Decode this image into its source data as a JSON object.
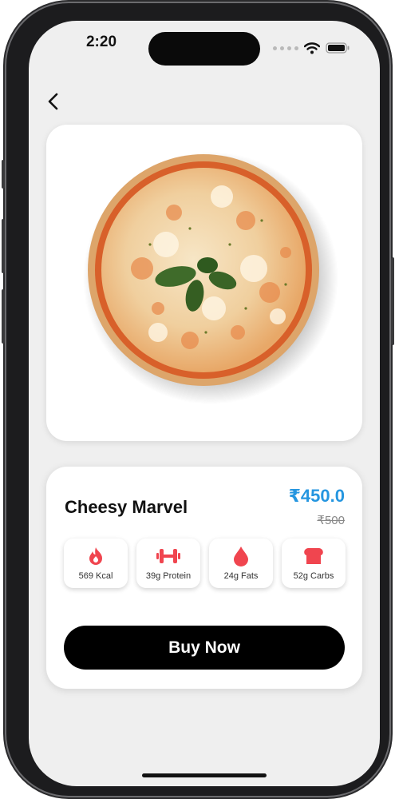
{
  "status_bar": {
    "time": "2:20",
    "icons": [
      "signal-dots-icon",
      "wifi-icon",
      "battery-icon"
    ]
  },
  "header": {
    "back_icon": "chevron-left-icon"
  },
  "product": {
    "image": "pizza-image",
    "name": "Cheesy Marvel",
    "price": "₹450.0",
    "original_price": "₹500",
    "nutrients": [
      {
        "icon": "flame-icon",
        "label": "569 Kcal"
      },
      {
        "icon": "dumbbell-icon",
        "label": "39g Protein"
      },
      {
        "icon": "drop-icon",
        "label": "24g Fats"
      },
      {
        "icon": "bread-icon",
        "label": "52g Carbs"
      }
    ]
  },
  "actions": {
    "buy_label": "Buy Now"
  },
  "colors": {
    "accent_price": "#2596e0",
    "nutrient_icon": "#f0454f",
    "button_bg": "#000000",
    "screen_bg": "#efefef"
  }
}
